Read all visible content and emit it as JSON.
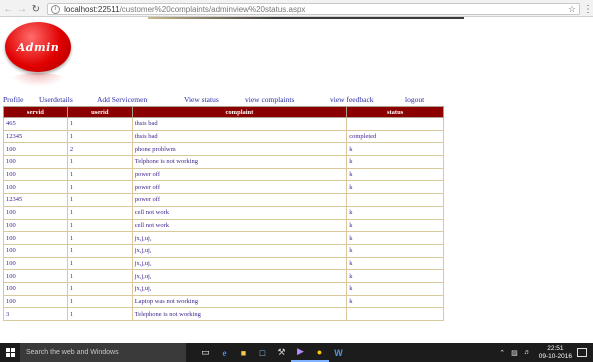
{
  "browser": {
    "url_host": "localhost:22511",
    "url_path": "/customer%20complaints/adminview%20status.aspx",
    "back_icon": "arrow-left",
    "forward_icon": "arrow-right",
    "reload_icon": "reload",
    "bookmark_icon": "star",
    "menu_icon": "vertical-dots"
  },
  "logo": {
    "text": "Admin",
    "color": "#e00000"
  },
  "nav": {
    "items": [
      {
        "label": "Profile"
      },
      {
        "label": "Userdetails"
      },
      {
        "label": "Add Servicemen"
      },
      {
        "label": "View status"
      },
      {
        "label": "view complaints"
      },
      {
        "label": "view feedback"
      },
      {
        "label": "logout"
      }
    ]
  },
  "table": {
    "headers": [
      "servid",
      "userid",
      "complaint",
      "status"
    ],
    "header_color": "#8b0000",
    "rows": [
      [
        "465",
        "1",
        "thsis bad",
        ""
      ],
      [
        "12345",
        "1",
        "thsis bad",
        "completed"
      ],
      [
        "100",
        "2",
        "phone problwm",
        "k"
      ],
      [
        "100",
        "1",
        "Telphone is not working",
        "k"
      ],
      [
        "100",
        "1",
        "power off",
        "k"
      ],
      [
        "100",
        "1",
        "power off",
        "k"
      ],
      [
        "12345",
        "1",
        "power off",
        ""
      ],
      [
        "100",
        "1",
        "cell not work",
        "k"
      ],
      [
        "100",
        "1",
        "cell not work",
        "k"
      ],
      [
        "100",
        "1",
        "jx,j,uj,",
        "k"
      ],
      [
        "100",
        "1",
        "jx,j,uj,",
        "k"
      ],
      [
        "100",
        "1",
        "jx,j,uj,",
        "k"
      ],
      [
        "100",
        "1",
        "jx,j,uj,",
        "k"
      ],
      [
        "100",
        "1",
        "jx,j,uj,",
        "k"
      ],
      [
        "100",
        "1",
        "Laptop was not working",
        "k"
      ],
      [
        "3",
        "1",
        "Telephone is not working",
        ""
      ]
    ]
  },
  "taskbar": {
    "search_placeholder": "Search the web and Windows",
    "pinned_icons": [
      "task-view",
      "edge",
      "file-explorer",
      "store",
      "tools",
      "visual-studio",
      "chrome",
      "word"
    ],
    "time": "22:51",
    "date": "09-10-2016"
  }
}
